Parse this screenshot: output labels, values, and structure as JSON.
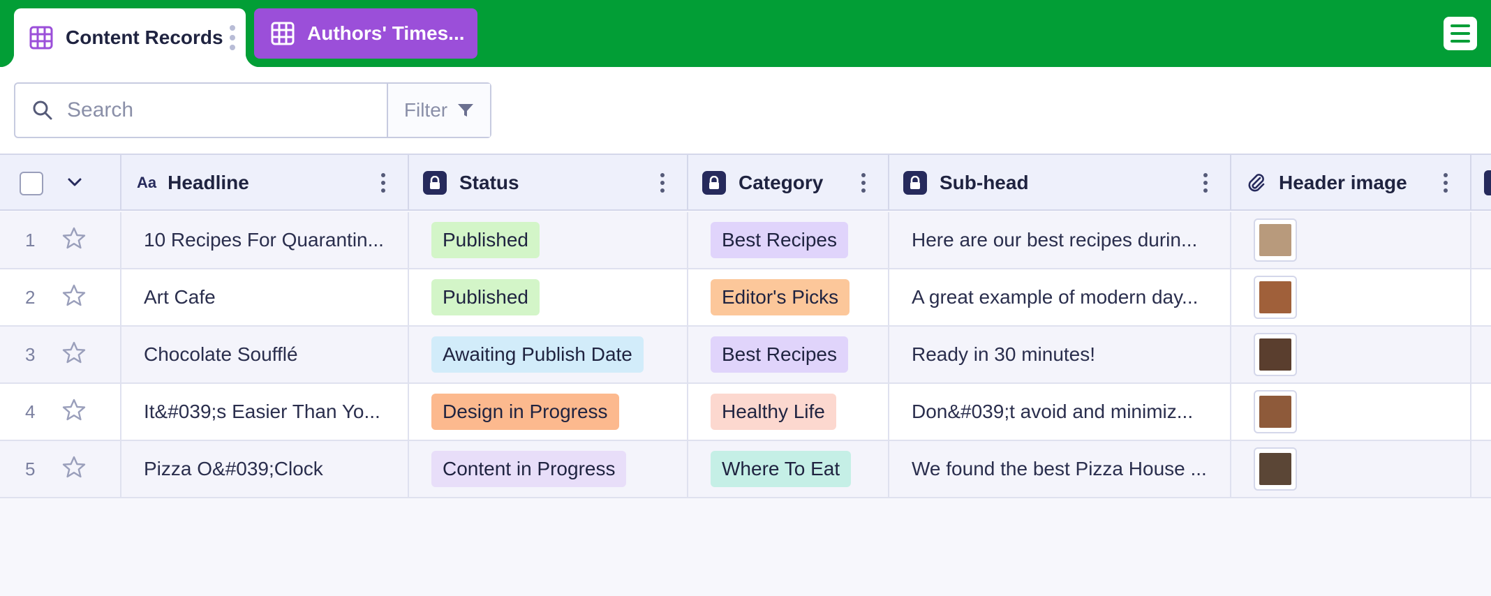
{
  "tabs": [
    {
      "label": "Content Records",
      "active": true
    },
    {
      "label": "Authors' Times...",
      "active": false
    }
  ],
  "search": {
    "placeholder": "Search",
    "value": ""
  },
  "filter": {
    "label": "Filter"
  },
  "columns": [
    {
      "label": "Headline",
      "icon": "text-aa-icon"
    },
    {
      "label": "Status",
      "icon": "lock-icon"
    },
    {
      "label": "Category",
      "icon": "lock-icon"
    },
    {
      "label": "Sub-head",
      "icon": "lock-icon"
    },
    {
      "label": "Header image",
      "icon": "paperclip-icon"
    }
  ],
  "rows": [
    {
      "num": "1",
      "headline": "10 Recipes For Quarantin...",
      "status": "Published",
      "status_color": "#d3f5c8",
      "category": "Best Recipes",
      "category_color": "#e0d4fb",
      "subhead": "Here are our best recipes durin...",
      "thumb_color": "#b89a7c"
    },
    {
      "num": "2",
      "headline": "Art Cafe",
      "status": "Published",
      "status_color": "#d3f5c8",
      "category": "Editor's Picks",
      "category_color": "#fcc79a",
      "subhead": "A great example of modern day...",
      "thumb_color": "#a0603a"
    },
    {
      "num": "3",
      "headline": "Chocolate Soufflé",
      "status": "Awaiting Publish Date",
      "status_color": "#d2ecfa",
      "category": "Best Recipes",
      "category_color": "#e0d4fb",
      "subhead": "Ready in 30 minutes!",
      "thumb_color": "#5a3e2e"
    },
    {
      "num": "4",
      "headline": "It&#039;s Easier Than Yo...",
      "status": "Design in Progress",
      "status_color": "#fcb98e",
      "category": "Healthy Life",
      "category_color": "#fcd8cf",
      "subhead": "Don&#039;t avoid and minimiz...",
      "thumb_color": "#8e5a3a"
    },
    {
      "num": "5",
      "headline": "Pizza O&#039;Clock",
      "status": "Content in Progress",
      "status_color": "#e8def9",
      "category": "Where To Eat",
      "category_color": "#c5efe6",
      "subhead": "We found the best Pizza House ...",
      "thumb_color": "#5b4636"
    }
  ],
  "colors": {
    "topbar": "#029e36",
    "tab_inactive": "#9b4fd9",
    "tab_icon": "#9b4fd9",
    "lock_bg": "#262a5c"
  }
}
